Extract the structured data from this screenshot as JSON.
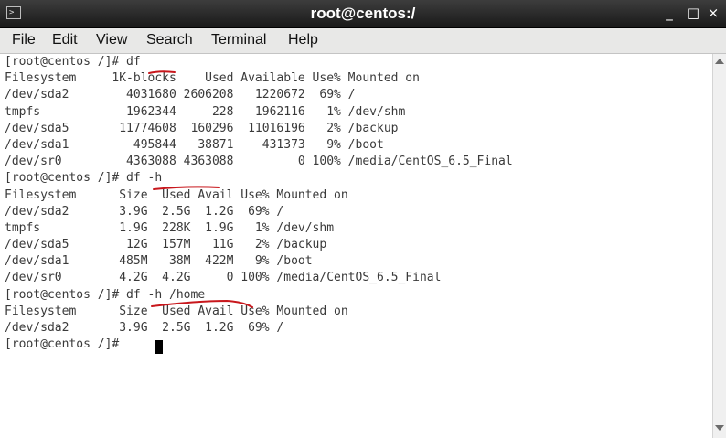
{
  "window": {
    "title": "root@centos:/",
    "app_icon": "terminal-icon",
    "controls": {
      "minimize": "_",
      "maximize": "□",
      "close": "×"
    }
  },
  "menu": {
    "items": [
      "File",
      "Edit",
      "View",
      "Search",
      "Terminal",
      "Help"
    ]
  },
  "terminal": {
    "lines": [
      "[root@centos /]# df",
      "Filesystem     1K-blocks    Used Available Use% Mounted on",
      "/dev/sda2        4031680 2606208   1220672  69% /",
      "tmpfs            1962344     228   1962116   1% /dev/shm",
      "/dev/sda5       11774608  160296  11016196   2% /backup",
      "/dev/sda1         495844   38871    431373   9% /boot",
      "/dev/sr0         4363088 4363088         0 100% /media/CentOS_6.5_Final",
      "[root@centos /]# df -h",
      "Filesystem      Size  Used Avail Use% Mounted on",
      "/dev/sda2       3.9G  2.5G  1.2G  69% /",
      "tmpfs           1.9G  228K  1.9G   1% /dev/shm",
      "/dev/sda5        12G  157M   11G   2% /backup",
      "/dev/sda1       485M   38M  422M   9% /boot",
      "/dev/sr0        4.2G  4.2G     0 100% /media/CentOS_6.5_Final",
      "[root@centos /]# df -h /home",
      "Filesystem      Size  Used Avail Use% Mounted on",
      "/dev/sda2       3.9G  2.5G  1.2G  69% /",
      "[root@centos /]# "
    ],
    "annotation_color": "#c8171c"
  },
  "scrollbar": {
    "up_icon": "chevron-up-icon",
    "down_icon": "chevron-down-icon"
  }
}
